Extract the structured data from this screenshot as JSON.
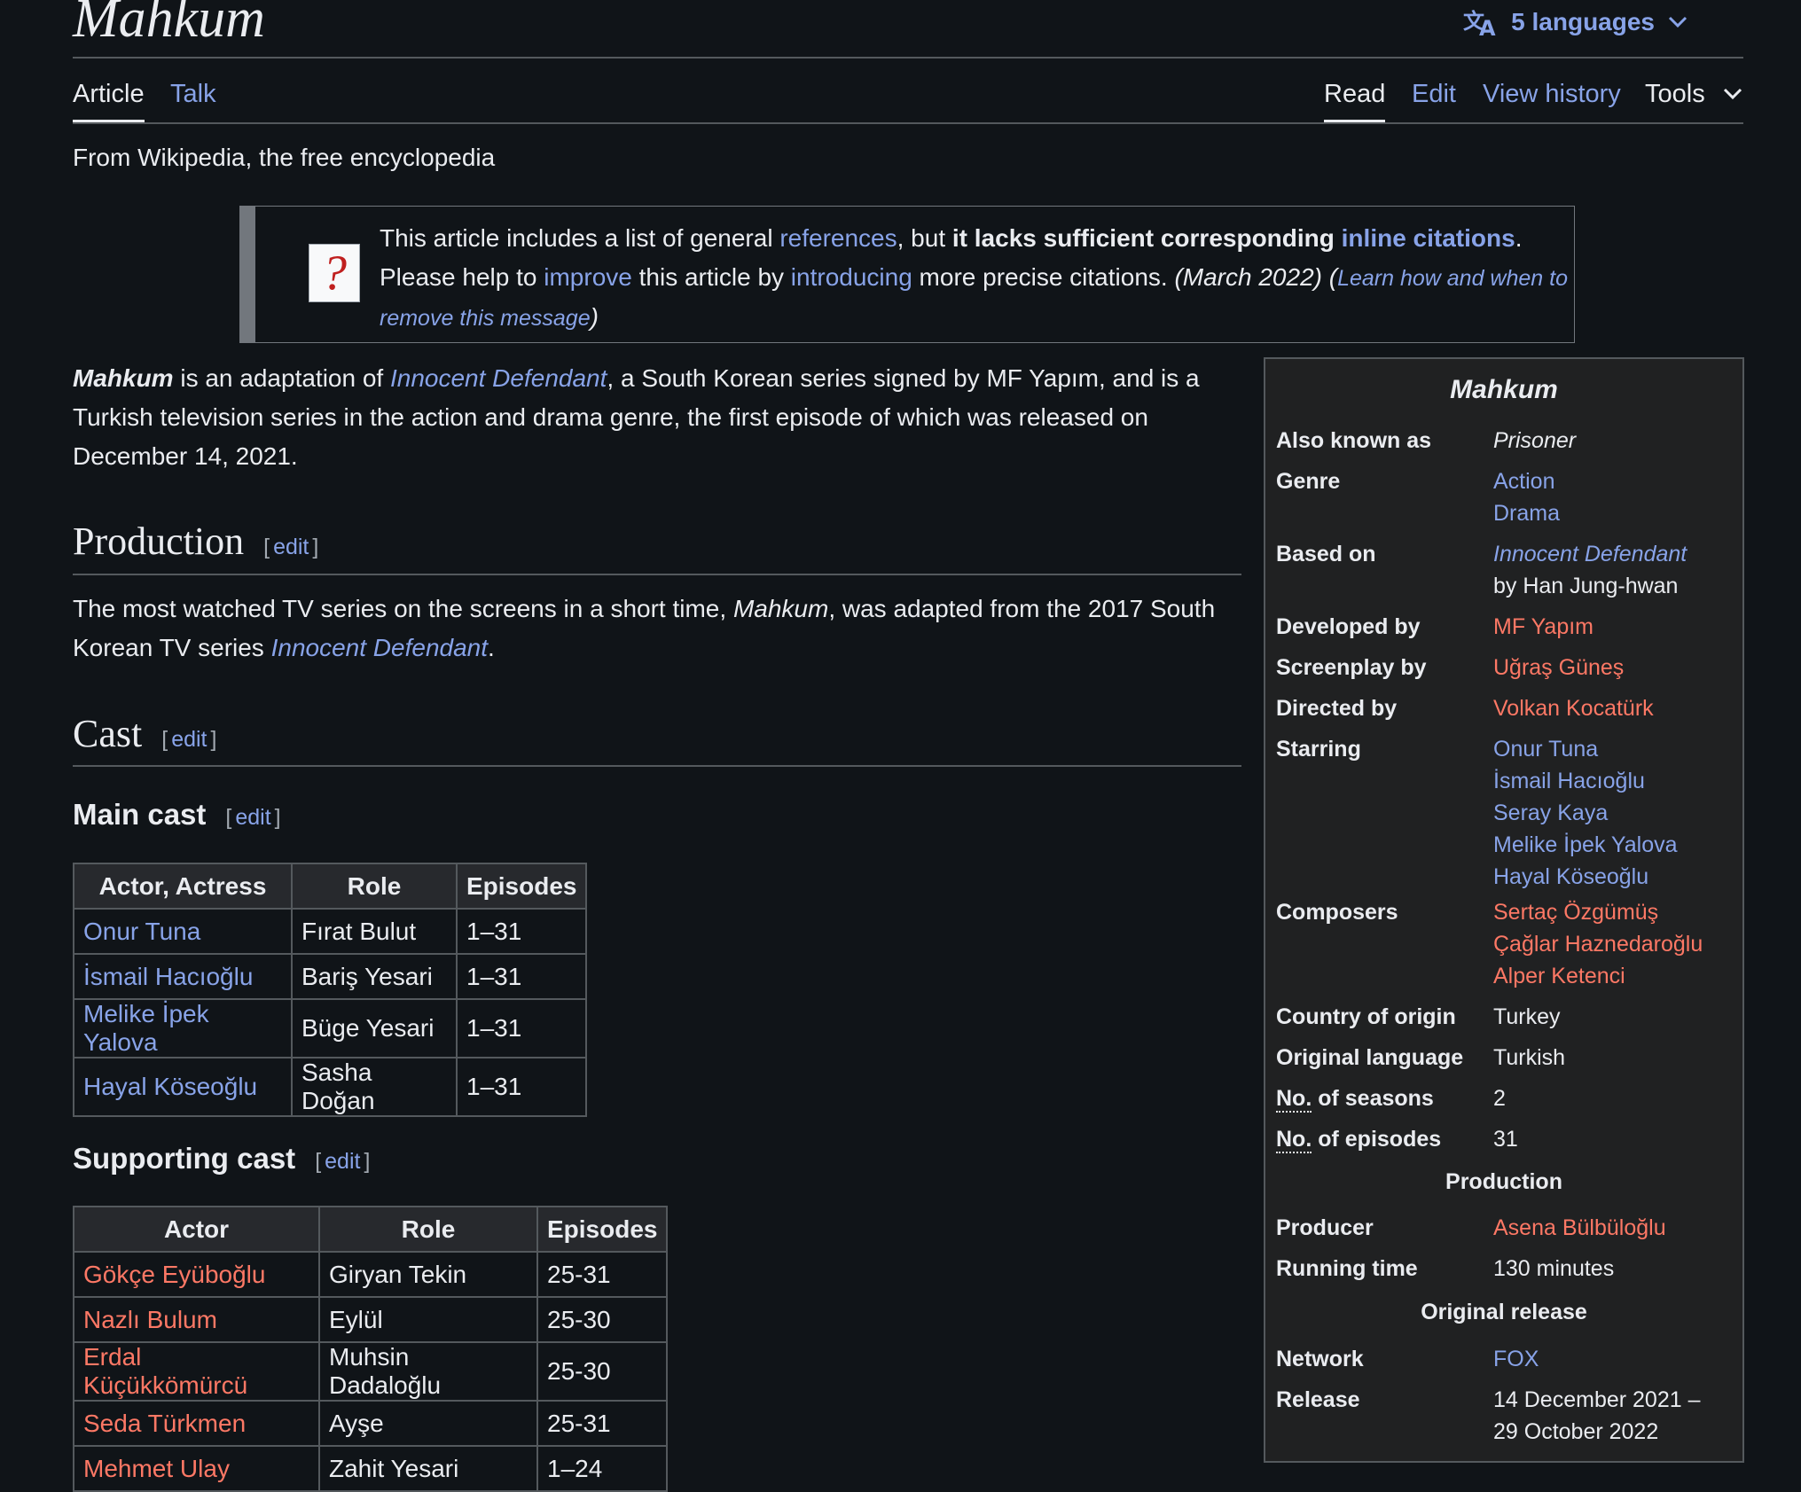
{
  "page": {
    "title": "Mahkum",
    "languages_label": "5 languages",
    "tabs_left": [
      "Article",
      "Talk"
    ],
    "tabs_right": [
      "Read",
      "Edit",
      "View history",
      "Tools"
    ],
    "tagline": "From Wikipedia, the free encyclopedia"
  },
  "ambox": {
    "t1": "This article includes a list of general ",
    "l1": "references",
    "t2": ", but ",
    "b1": "it lacks sufficient corresponding ",
    "l2": "inline citations",
    "t3": ".",
    "t4": "Please help to ",
    "l3": "improve",
    "t5": " this article by ",
    "l4": "introducing",
    "t6": " more precise citations. ",
    "date": "(March 2022)",
    "t7": " (",
    "l5": "Learn how and when to remove this message",
    "t8": ")"
  },
  "intro": {
    "name": "Mahkum",
    "t1": " is an adaptation of ",
    "link": "Innocent Defendant",
    "t2": ", a South Korean series signed by MF Yapım, and is a Turkish television series in the action and drama genre, the first episode of which was released on December 14, 2021."
  },
  "sections": {
    "edit": "edit",
    "production": "Production",
    "production_text1": "The most watched TV series on the screens in a short time, ",
    "production_name": "Mahkum",
    "production_text2": ", was adapted from the 2017 South Korean TV series ",
    "production_link": "Innocent Defendant",
    "production_text3": ".",
    "cast": "Cast",
    "main_cast": "Main cast",
    "supporting_cast": "Supporting cast"
  },
  "main_cast_table": {
    "headers": [
      "Actor, Actress",
      "Role",
      "Episodes"
    ],
    "rows": [
      [
        "Onur Tuna",
        "Fırat Bulut",
        "1–31"
      ],
      [
        "İsmail Hacıoğlu",
        "Bariş Yesari",
        "1–31"
      ],
      [
        "Melike İpek Yalova",
        "Büge Yesari",
        "1–31"
      ],
      [
        "Hayal Köseoğlu",
        "Sasha Doğan",
        "1–31"
      ]
    ]
  },
  "supporting_cast_table": {
    "headers": [
      "Actor",
      "Role",
      "Episodes"
    ],
    "rows": [
      [
        "Gökçe Eyüboğlu",
        "Giryan Tekin",
        "25-31"
      ],
      [
        "Nazlı Bulum",
        "Eylül",
        "25-30"
      ],
      [
        "Erdal Küçükkömürcü",
        "Muhsin Dadaloğlu",
        "25-30"
      ],
      [
        "Seda Türkmen",
        "Ayşe",
        "25-31"
      ],
      [
        "Mehmet Ulay",
        "Zahit Yesari",
        "1–24"
      ]
    ]
  },
  "infobox": {
    "title": "Mahkum",
    "also_known_as_label": "Also known as",
    "also_known_as": "Prisoner",
    "genre_label": "Genre",
    "genre": [
      "Action",
      "Drama"
    ],
    "based_on_label": "Based on",
    "based_on_link": "Innocent Defendant",
    "based_on_by": "by Han Jung-hwan",
    "developed_by_label": "Developed by",
    "developed_by": "MF Yapım",
    "screenplay_by_label": "Screenplay by",
    "screenplay_by": "Uğraş Güneş",
    "directed_by_label": "Directed by",
    "directed_by": "Volkan Kocatürk",
    "starring_label": "Starring",
    "starring": [
      "Onur Tuna",
      "İsmail Hacıoğlu",
      "Seray Kaya",
      "Melike İpek Yalova",
      "Hayal Köseoğlu"
    ],
    "composers_label": "Composers",
    "composers": [
      "Sertaç Özgümüş",
      "Çağlar Haznedaroğlu",
      "Alper Ketenci"
    ],
    "country_label": "Country of origin",
    "country": "Turkey",
    "language_label": "Original language",
    "language": "Turkish",
    "no_label": "No.",
    "seasons_label_rest": " of seasons",
    "seasons": "2",
    "episodes_label_rest": " of episodes",
    "episodes": "31",
    "production_head": "Production",
    "producer_label": "Producer",
    "producer": "Asena Bülbüloğlu",
    "running_time_label": "Running time",
    "running_time": "130 minutes",
    "release_head": "Original release",
    "network_label": "Network",
    "network": "FOX",
    "release_label": "Release",
    "release_1": "14 December 2021 –",
    "release_2": "29 October 2022"
  },
  "colors": {
    "link": "#88a3e8",
    "redlink": "#fd7865",
    "background": "#101418"
  },
  "icons": [
    "translate-icon",
    "chevron-down-icon",
    "question-mark-icon"
  ]
}
